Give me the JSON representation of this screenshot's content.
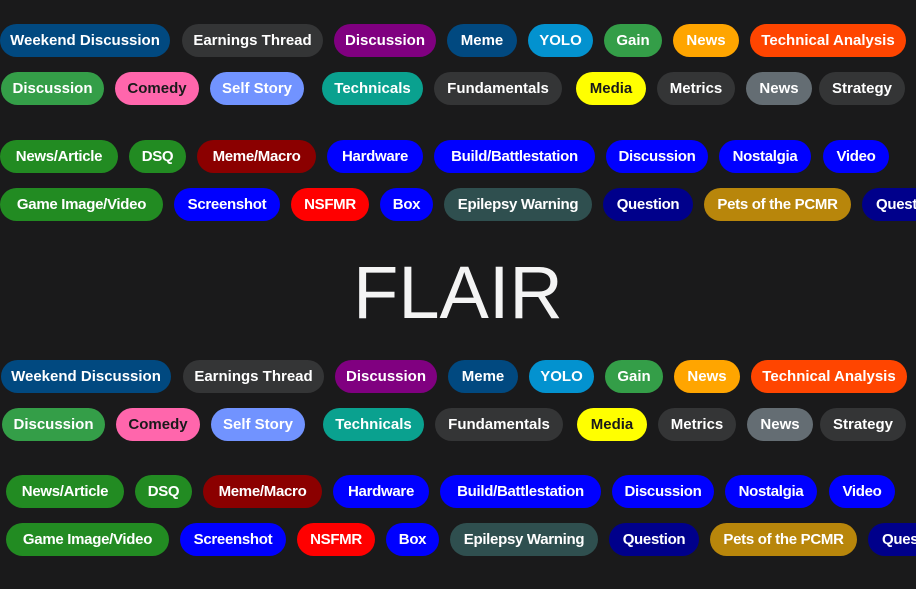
{
  "title": "FLAIR",
  "flair_sets": [
    {
      "rows": [
        [
          {
            "label": "Weekend Discussion",
            "bg": "#014980",
            "fg": "#ffffff"
          },
          {
            "label": "Earnings Thread",
            "bg": "#343536",
            "fg": "#ffffff"
          },
          {
            "label": "Discussion",
            "bg": "#800080",
            "fg": "#ffffff"
          },
          {
            "label": "Meme",
            "bg": "#014980",
            "fg": "#ffffff"
          },
          {
            "label": "YOLO",
            "bg": "#0392cf",
            "fg": "#ffffff"
          },
          {
            "label": "Gain",
            "bg": "#349e48",
            "fg": "#ffffff"
          },
          {
            "label": "News",
            "bg": "#ffa500",
            "fg": "#ffffff"
          },
          {
            "label": "Technical Analysis",
            "bg": "#ff4500",
            "fg": "#ffffff"
          }
        ],
        [
          {
            "label": "Discussion",
            "bg": "#349e48",
            "fg": "#ffffff"
          },
          {
            "label": "Comedy",
            "bg": "#ff66ac",
            "fg": "#1a1a1b"
          },
          {
            "label": "Self Story",
            "bg": "#7193ff",
            "fg": "#ffffff"
          },
          {
            "label": "Technicals",
            "bg": "#0aa18f",
            "fg": "#ffffff"
          },
          {
            "label": "Fundamentals",
            "bg": "#343536",
            "fg": "#ffffff"
          },
          {
            "label": "Media",
            "bg": "#ffff00",
            "fg": "#1a1a1b"
          },
          {
            "label": "Metrics",
            "bg": "#343536",
            "fg": "#ffffff"
          },
          {
            "label": "News",
            "bg": "#646d73",
            "fg": "#ffffff"
          },
          {
            "label": "Strategy",
            "bg": "#343536",
            "fg": "#ffffff"
          }
        ],
        [
          {
            "label": "News/Article",
            "bg": "#228b22",
            "fg": "#ffffff"
          },
          {
            "label": "DSQ",
            "bg": "#228b22",
            "fg": "#ffffff"
          },
          {
            "label": "Meme/Macro",
            "bg": "#8b0000",
            "fg": "#ffffff"
          },
          {
            "label": "Hardware",
            "bg": "#0000ff",
            "fg": "#ffffff"
          },
          {
            "label": "Build/Battlestation",
            "bg": "#0000ff",
            "fg": "#ffffff"
          },
          {
            "label": "Discussion",
            "bg": "#0000ff",
            "fg": "#ffffff"
          },
          {
            "label": "Nostalgia",
            "bg": "#0000ff",
            "fg": "#ffffff"
          },
          {
            "label": "Video",
            "bg": "#0000ff",
            "fg": "#ffffff"
          }
        ],
        [
          {
            "label": "Game Image/Video",
            "bg": "#228b22",
            "fg": "#ffffff"
          },
          {
            "label": "Screenshot",
            "bg": "#0000ff",
            "fg": "#ffffff"
          },
          {
            "label": "NSFMR",
            "bg": "#ff0000",
            "fg": "#ffffff"
          },
          {
            "label": "Box",
            "bg": "#0000ff",
            "fg": "#ffffff"
          },
          {
            "label": "Epilepsy Warning",
            "bg": "#2f4f4f",
            "fg": "#ffffff"
          },
          {
            "label": "Question",
            "bg": "#00008b",
            "fg": "#ffffff"
          },
          {
            "label": "Pets of the PCMR",
            "bg": "#b8860b",
            "fg": "#ffffff"
          },
          {
            "label": "Question",
            "bg": "#00008b",
            "fg": "#ffffff"
          }
        ]
      ]
    },
    {
      "rows": [
        [
          {
            "label": "Weekend Discussion",
            "bg": "#014980",
            "fg": "#ffffff"
          },
          {
            "label": "Earnings Thread",
            "bg": "#343536",
            "fg": "#ffffff"
          },
          {
            "label": "Discussion",
            "bg": "#800080",
            "fg": "#ffffff"
          },
          {
            "label": "Meme",
            "bg": "#014980",
            "fg": "#ffffff"
          },
          {
            "label": "YOLO",
            "bg": "#0392cf",
            "fg": "#ffffff"
          },
          {
            "label": "Gain",
            "bg": "#349e48",
            "fg": "#ffffff"
          },
          {
            "label": "News",
            "bg": "#ffa500",
            "fg": "#ffffff"
          },
          {
            "label": "Technical Analysis",
            "bg": "#ff4500",
            "fg": "#ffffff"
          }
        ],
        [
          {
            "label": "Discussion",
            "bg": "#349e48",
            "fg": "#ffffff"
          },
          {
            "label": "Comedy",
            "bg": "#ff66ac",
            "fg": "#1a1a1b"
          },
          {
            "label": "Self Story",
            "bg": "#7193ff",
            "fg": "#ffffff"
          },
          {
            "label": "Technicals",
            "bg": "#0aa18f",
            "fg": "#ffffff"
          },
          {
            "label": "Fundamentals",
            "bg": "#343536",
            "fg": "#ffffff"
          },
          {
            "label": "Media",
            "bg": "#ffff00",
            "fg": "#1a1a1b"
          },
          {
            "label": "Metrics",
            "bg": "#343536",
            "fg": "#ffffff"
          },
          {
            "label": "News",
            "bg": "#646d73",
            "fg": "#ffffff"
          },
          {
            "label": "Strategy",
            "bg": "#343536",
            "fg": "#ffffff"
          }
        ],
        [
          {
            "label": "News/Article",
            "bg": "#228b22",
            "fg": "#ffffff"
          },
          {
            "label": "DSQ",
            "bg": "#228b22",
            "fg": "#ffffff"
          },
          {
            "label": "Meme/Macro",
            "bg": "#8b0000",
            "fg": "#ffffff"
          },
          {
            "label": "Hardware",
            "bg": "#0000ff",
            "fg": "#ffffff"
          },
          {
            "label": "Build/Battlestation",
            "bg": "#0000ff",
            "fg": "#ffffff"
          },
          {
            "label": "Discussion",
            "bg": "#0000ff",
            "fg": "#ffffff"
          },
          {
            "label": "Nostalgia",
            "bg": "#0000ff",
            "fg": "#ffffff"
          },
          {
            "label": "Video",
            "bg": "#0000ff",
            "fg": "#ffffff"
          }
        ],
        [
          {
            "label": "Game Image/Video",
            "bg": "#228b22",
            "fg": "#ffffff"
          },
          {
            "label": "Screenshot",
            "bg": "#0000ff",
            "fg": "#ffffff"
          },
          {
            "label": "NSFMR",
            "bg": "#ff0000",
            "fg": "#ffffff"
          },
          {
            "label": "Box",
            "bg": "#0000ff",
            "fg": "#ffffff"
          },
          {
            "label": "Epilepsy Warning",
            "bg": "#2f4f4f",
            "fg": "#ffffff"
          },
          {
            "label": "Question",
            "bg": "#00008b",
            "fg": "#ffffff"
          },
          {
            "label": "Pets of the PCMR",
            "bg": "#b8860b",
            "fg": "#ffffff"
          },
          {
            "label": "Question",
            "bg": "#00008b",
            "fg": "#ffffff"
          }
        ]
      ]
    }
  ]
}
